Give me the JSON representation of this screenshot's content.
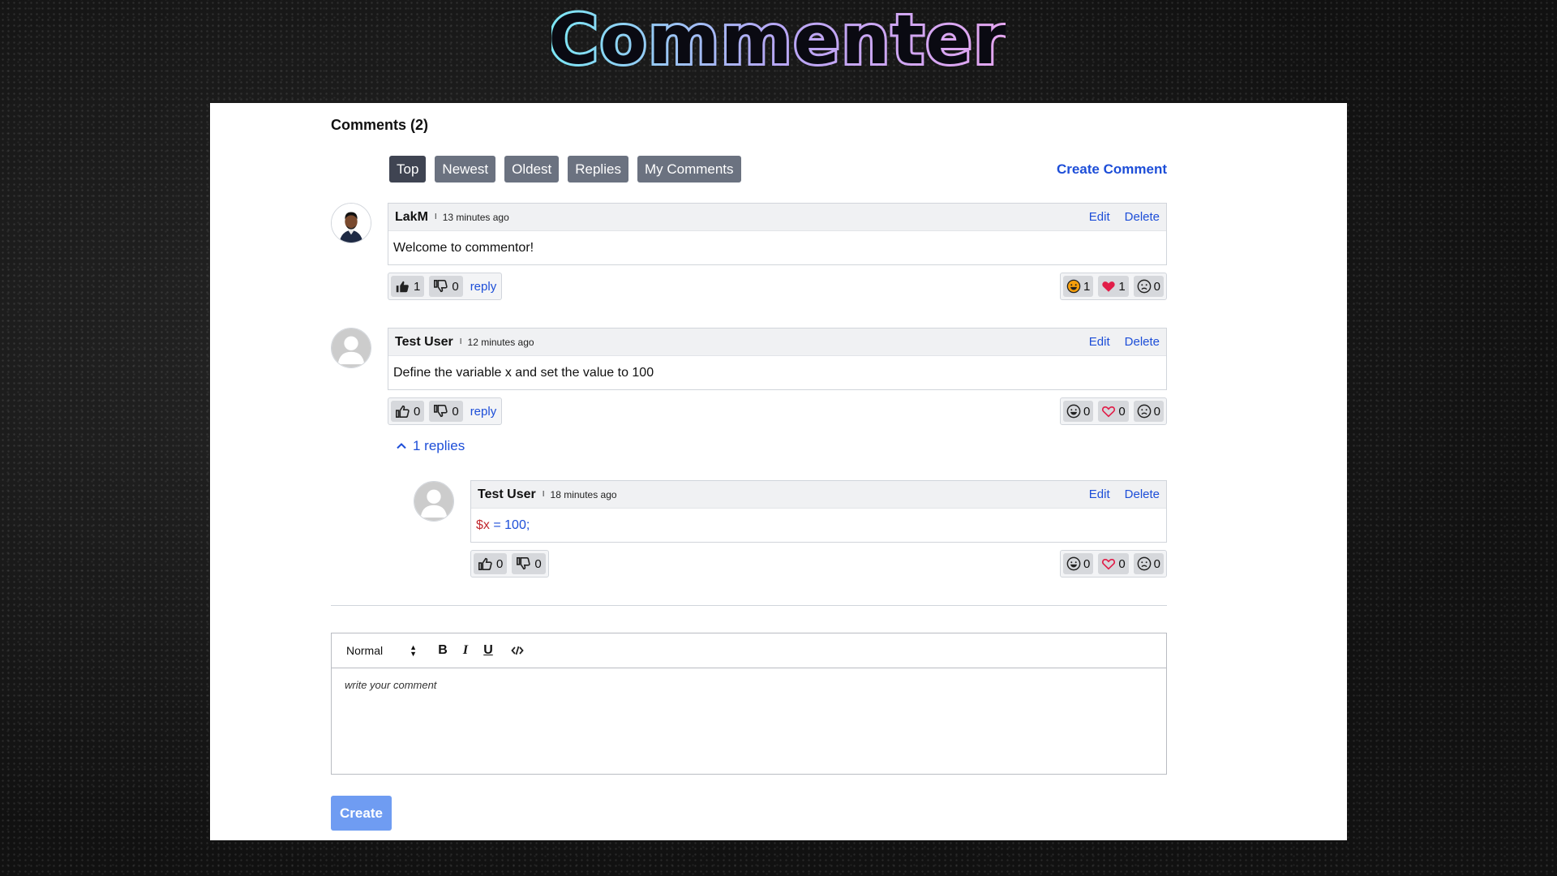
{
  "app": {
    "logo_text": "Commenter"
  },
  "comments_header": {
    "title": "Comments (2)"
  },
  "tabs": [
    {
      "label": "Top",
      "active": true
    },
    {
      "label": "Newest",
      "active": false
    },
    {
      "label": "Oldest",
      "active": false
    },
    {
      "label": "Replies",
      "active": false
    },
    {
      "label": "My Comments",
      "active": false
    }
  ],
  "create_comment_label": "Create Comment",
  "actions": {
    "edit": "Edit",
    "delete": "Delete",
    "reply": "reply"
  },
  "comments": [
    {
      "author": "LakM",
      "time": "13 minutes ago",
      "separator": "I",
      "text": "Welcome to commentor!",
      "likes": "1",
      "dislikes": "0",
      "reactions": {
        "haha": "1",
        "love": "1",
        "sad": "0"
      },
      "avatar": "photo-avatar"
    },
    {
      "author": "Test User",
      "time": "12 minutes ago",
      "separator": "I",
      "text": "Define the variable x and set the value to 100",
      "likes": "0",
      "dislikes": "0",
      "reactions": {
        "haha": "0",
        "love": "0",
        "sad": "0"
      },
      "avatar": "default-avatar",
      "replies_label": "1 replies",
      "replies": [
        {
          "author": "Test User",
          "time": "18 minutes ago",
          "separator": "I",
          "code_var": "$x",
          "code_rest": " = 100;",
          "likes": "0",
          "dislikes": "0",
          "reactions": {
            "haha": "0",
            "love": "0",
            "sad": "0"
          },
          "avatar": "default-avatar"
        }
      ]
    }
  ],
  "editor": {
    "format": "Normal",
    "tools": {
      "bold": "B",
      "italic": "I",
      "underline": "U"
    },
    "placeholder": "write your comment"
  },
  "submit_label": "Create",
  "colors": {
    "link": "#1d4ed8",
    "tab": "#6b7280",
    "tab_active": "#3f4452",
    "create_button": "#6f9cf2",
    "love_active": "#e11d48",
    "haha_active": "#f59e0b"
  },
  "icons": [
    "thumbs-up-icon",
    "thumbs-down-icon",
    "haha-icon",
    "heart-icon",
    "sad-icon",
    "chevron-up-icon",
    "code-icon",
    "sort-arrows-icon"
  ]
}
